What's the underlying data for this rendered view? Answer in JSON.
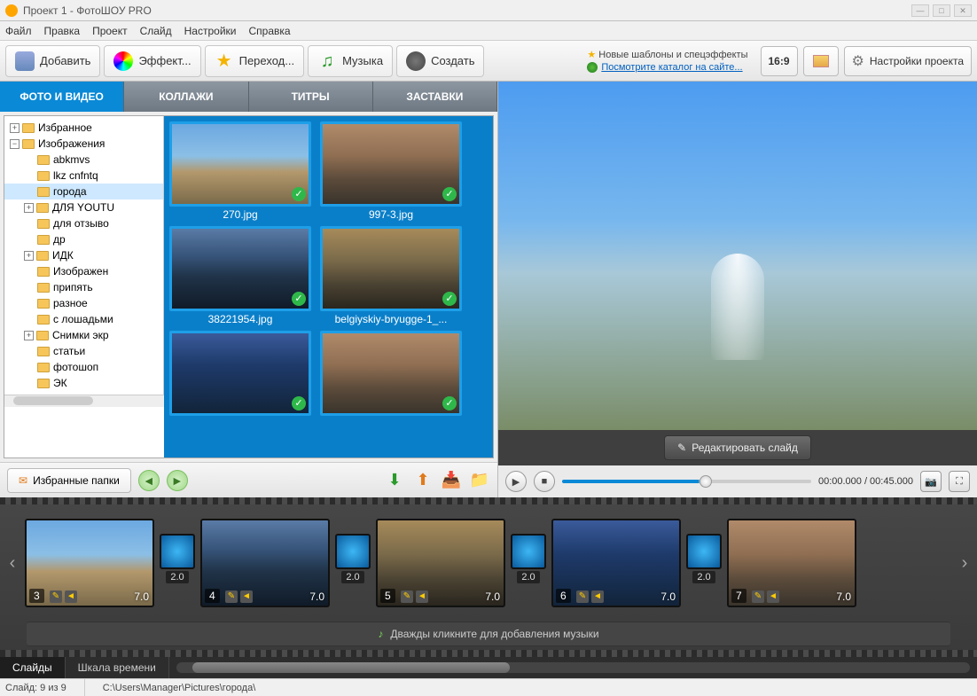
{
  "window": {
    "title": "Проект 1 - ФотоШОУ PRO"
  },
  "menu": [
    "Файл",
    "Правка",
    "Проект",
    "Слайд",
    "Настройки",
    "Справка"
  ],
  "toolbar": {
    "add": "Добавить",
    "effects": "Эффект...",
    "transitions": "Переход...",
    "music": "Музыка",
    "create": "Создать"
  },
  "info": {
    "templates": "Новые шаблоны и спецэффекты",
    "catalog": "Посмотрите каталог на сайте..."
  },
  "aspect": "16:9",
  "project_settings": "Настройки проекта",
  "left_tabs": [
    "ФОТО И ВИДЕО",
    "КОЛЛАЖИ",
    "ТИТРЫ",
    "ЗАСТАВКИ"
  ],
  "tree": [
    {
      "indent": 0,
      "exp": "+",
      "label": "Избранное"
    },
    {
      "indent": 0,
      "exp": "−",
      "label": "Изображения"
    },
    {
      "indent": 1,
      "exp": "",
      "label": "abkmvs"
    },
    {
      "indent": 1,
      "exp": "",
      "label": "lkz cnfntq"
    },
    {
      "indent": 1,
      "exp": "",
      "label": "города",
      "selected": true
    },
    {
      "indent": 1,
      "exp": "+",
      "label": "ДЛЯ YOUTU"
    },
    {
      "indent": 1,
      "exp": "",
      "label": "для отзыво"
    },
    {
      "indent": 1,
      "exp": "",
      "label": "др"
    },
    {
      "indent": 1,
      "exp": "+",
      "label": "ИДК"
    },
    {
      "indent": 1,
      "exp": "",
      "label": "Изображен"
    },
    {
      "indent": 1,
      "exp": "",
      "label": "припять"
    },
    {
      "indent": 1,
      "exp": "",
      "label": "разное"
    },
    {
      "indent": 1,
      "exp": "",
      "label": "с лошадьми"
    },
    {
      "indent": 1,
      "exp": "+",
      "label": "Снимки экр"
    },
    {
      "indent": 1,
      "exp": "",
      "label": "статьи"
    },
    {
      "indent": 1,
      "exp": "",
      "label": "фотошоп"
    },
    {
      "indent": 1,
      "exp": "",
      "label": "ЭК"
    }
  ],
  "thumbs": [
    {
      "name": "270.jpg",
      "cls": "g1"
    },
    {
      "name": "997-3.jpg",
      "cls": "g2"
    },
    {
      "name": "38221954.jpg",
      "cls": "g3"
    },
    {
      "name": "belgiyskiy-bryugge-1_...",
      "cls": "g4"
    },
    {
      "name": "",
      "cls": "g5"
    },
    {
      "name": "",
      "cls": "g2"
    }
  ],
  "fav_folders": "Избранные папки",
  "edit_slide": "Редактировать слайд",
  "timecode": "00:00.000 / 00:45.000",
  "music_hint": "Дважды кликните для добавления музыки",
  "bottom_tabs": [
    "Слайды",
    "Шкала времени"
  ],
  "slides": [
    {
      "num": "3",
      "dur": "7.0",
      "trans": "2.0",
      "cls": "g1"
    },
    {
      "num": "4",
      "dur": "7.0",
      "trans": "2.0",
      "cls": "g3"
    },
    {
      "num": "5",
      "dur": "7.0",
      "trans": "2.0",
      "cls": "g4"
    },
    {
      "num": "6",
      "dur": "7.0",
      "trans": "2.0",
      "cls": "g5"
    },
    {
      "num": "7",
      "dur": "7.0",
      "trans": "",
      "cls": "g2"
    }
  ],
  "status": {
    "slide": "Слайд: 9 из 9",
    "path": "C:\\Users\\Manager\\Pictures\\города\\"
  }
}
